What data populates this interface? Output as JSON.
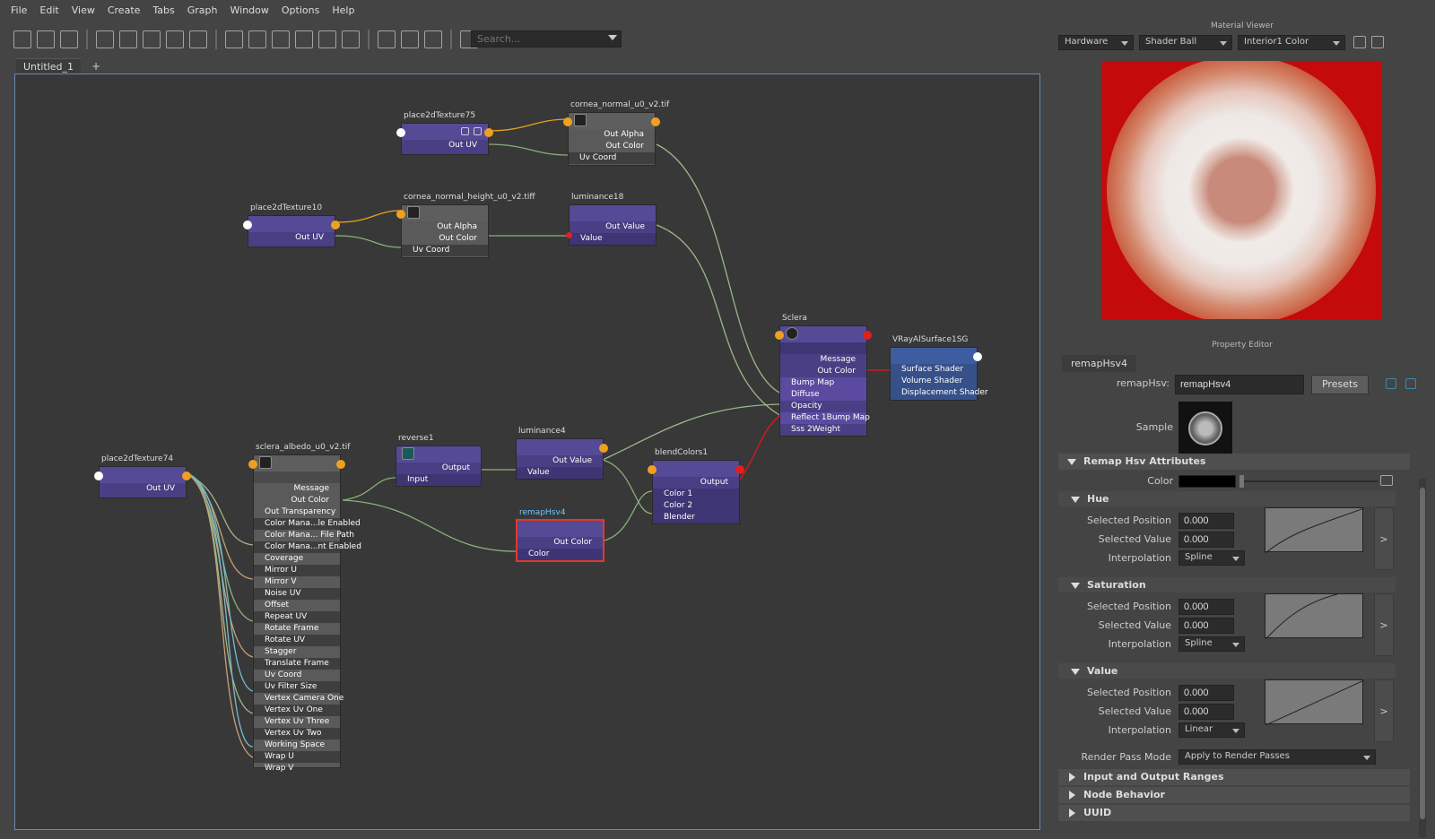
{
  "menu": [
    "File",
    "Edit",
    "View",
    "Create",
    "Tabs",
    "Graph",
    "Window",
    "Options",
    "Help"
  ],
  "search": {
    "placeholder": "Search..."
  },
  "tabs": {
    "current": "Untitled_1",
    "add": "+"
  },
  "nodes": {
    "place2dTexture75": {
      "title": "place2dTexture75",
      "out_uv": "Out UV"
    },
    "cornea_normal": {
      "title": "cornea_normal_u0_v2.tif",
      "out_alpha": "Out Alpha",
      "out_color": "Out Color",
      "uv_coord": "Uv Coord"
    },
    "place2dTexture10": {
      "title": "place2dTexture10",
      "out_uv": "Out UV"
    },
    "cornea_normal_height": {
      "title": "cornea_normal_height_u0_v2.tiff",
      "out_alpha": "Out Alpha",
      "out_color": "Out Color",
      "uv_coord": "Uv Coord"
    },
    "luminance18": {
      "title": "luminance18",
      "out_value": "Out Value",
      "value": "Value"
    },
    "sclera": {
      "title": "Sclera",
      "rows": [
        "Message",
        "Out Color",
        "Bump Map",
        "Diffuse",
        "Opacity",
        "Reflect 1Bump Map",
        "Sss 2Weight"
      ]
    },
    "vray_sg": {
      "title": "VRayAlSurface1SG",
      "rows": [
        "Surface Shader",
        "Volume Shader",
        "Displacement Shader"
      ]
    },
    "place2dTexture74": {
      "title": "place2dTexture74",
      "out_uv": "Out UV"
    },
    "sclera_albedo": {
      "title": "sclera_albedo_u0_v2.tif",
      "rows": [
        "Message",
        "Out Color",
        "Out Transparency",
        "Color Mana...le Enabled",
        "Color Mana... File Path",
        "Color Mana...nt Enabled",
        "Coverage",
        "Mirror U",
        "Mirror V",
        "Noise UV",
        "Offset",
        "Repeat UV",
        "Rotate Frame",
        "Rotate UV",
        "Stagger",
        "Translate Frame",
        "Uv Coord",
        "Uv Filter Size",
        "Vertex Camera One",
        "Vertex Uv One",
        "Vertex Uv Three",
        "Vertex Uv Two",
        "Working Space",
        "Wrap U",
        "Wrap V"
      ]
    },
    "reverse1": {
      "title": "reverse1",
      "output": "Output",
      "input": "Input"
    },
    "luminance4": {
      "title": "luminance4",
      "out_value": "Out Value",
      "value": "Value"
    },
    "blendColors1": {
      "title": "blendColors1",
      "output": "Output",
      "color1": "Color 1",
      "color2": "Color 2",
      "blender": "Blender"
    },
    "remapHsv4": {
      "title": "remapHsv4",
      "out_color": "Out Color",
      "color": "Color"
    }
  },
  "material_viewer": {
    "title": "Material Viewer",
    "renderer": "Hardware",
    "shape": "Shader Ball",
    "env": "Interior1 Color"
  },
  "property_editor": {
    "title": "Property Editor",
    "tab": "remapHsv4",
    "node_label": "remapHsv:",
    "node_name": "remapHsv4",
    "presets": "Presets",
    "sample": "Sample",
    "section_main": "Remap Hsv Attributes",
    "color_label": "Color",
    "hue": {
      "title": "Hue",
      "pos_label": "Selected Position",
      "pos": "0.000",
      "val_label": "Selected Value",
      "val": "0.000",
      "interp_label": "Interpolation",
      "interp": "Spline"
    },
    "saturation": {
      "title": "Saturation",
      "pos_label": "Selected Position",
      "pos": "0.000",
      "val_label": "Selected Value",
      "val": "0.000",
      "interp_label": "Interpolation",
      "interp": "Spline"
    },
    "value": {
      "title": "Value",
      "pos_label": "Selected Position",
      "pos": "0.000",
      "val_label": "Selected Value",
      "val": "0.000",
      "interp_label": "Interpolation",
      "interp": "Linear"
    },
    "render_pass_label": "Render Pass Mode",
    "render_pass": "Apply to Render Passes",
    "io_ranges": "Input and Output Ranges",
    "node_behavior": "Node Behavior",
    "uuid": "UUID",
    "expand_arrow": ">"
  }
}
